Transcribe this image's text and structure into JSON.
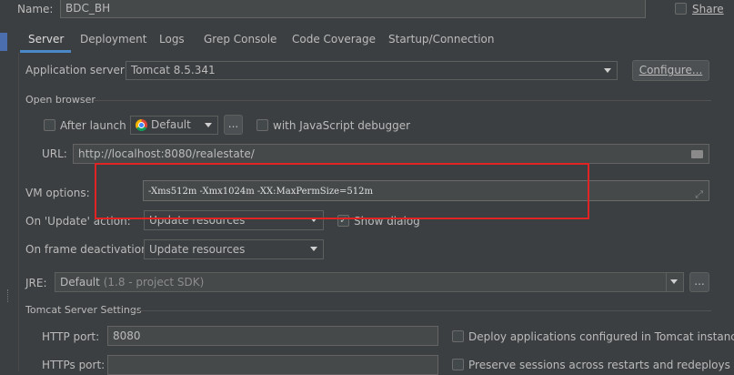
{
  "header": {
    "name_label": "Name:",
    "name_value": "BDC_BH",
    "share_label": "Share"
  },
  "tabs": [
    {
      "label": "Server",
      "active": true
    },
    {
      "label": "Deployment"
    },
    {
      "label": "Logs"
    },
    {
      "label": "Grep Console"
    },
    {
      "label": "Code Coverage"
    },
    {
      "label": "Startup/Connection"
    }
  ],
  "server": {
    "app_server_label": "Application server:",
    "app_server_value": "Tomcat 8.5.341",
    "configure_label": "Configure...",
    "open_browser_label": "Open browser",
    "after_launch_label": "After launch",
    "browser_value": "Default",
    "browse_button": "...",
    "js_debugger_label": "with JavaScript debugger",
    "url_label": "URL:",
    "url_value": "http://localhost:8080/realestate/",
    "vm_options_label": "VM options:",
    "vm_options_value": "-Xms512m -Xmx1024m -XX:MaxPermSize=512m",
    "on_update_label": "On 'Update' action:",
    "on_update_value": "Update resources",
    "show_dialog_label": "Show dialog",
    "show_dialog_checked": true,
    "on_frame_label": "On frame deactivation:",
    "on_frame_value": "Update resources",
    "jre_label": "JRE:",
    "jre_value": "Default",
    "jre_hint": "(1.8 - project SDK)",
    "jre_browse": "...",
    "tomcat_settings_label": "Tomcat Server Settings",
    "http_port_label": "HTTP port:",
    "http_port_value": "8080",
    "deploy_label": "Deploy applications configured in Tomcat instance",
    "https_port_label": "HTTPs port:",
    "preserve_label": "Preserve sessions across restarts and redeploys"
  },
  "colors": {
    "background": "#3c3f41",
    "field": "#45494a",
    "highlight": "#e02424",
    "accent_tab": "#4a88c7"
  }
}
